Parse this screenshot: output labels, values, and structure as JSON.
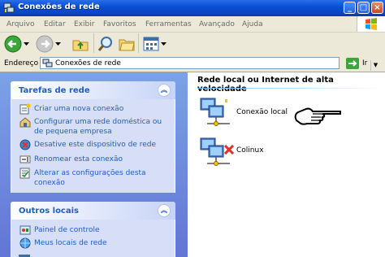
{
  "window": {
    "title": "Conexões de rede",
    "buttons": [
      "_",
      "□",
      "×"
    ]
  },
  "menu": [
    "Arquivo",
    "Editar",
    "Exibir",
    "Favoritos",
    "Ferramentas",
    "Avançado",
    "Ajuda"
  ],
  "toolbar": {
    "icons": [
      "back-arrow-icon",
      "dropdown-icon",
      "forward-arrow-icon",
      "dropdown-icon",
      "up-folder-icon",
      "search-icon",
      "folders-icon",
      "views-icon"
    ]
  },
  "address": {
    "label": "Endereço",
    "value": "Conexões de rede",
    "go_label": "Ir"
  },
  "left": {
    "tasks_title": "Tarefas de rede",
    "tasks": [
      {
        "label": "Criar uma nova conexão",
        "icon": "new-connection-icon"
      },
      {
        "label": "Configurar uma rede doméstica ou de pequena empresa",
        "icon": "home-network-icon"
      },
      {
        "label": "Desative este dispositivo de rede",
        "icon": "disable-device-icon"
      },
      {
        "label": "Renomear esta conexão",
        "icon": "rename-icon"
      },
      {
        "label": "Alterar as configurações desta conexão",
        "icon": "settings-icon"
      }
    ],
    "places_title": "Outros locais",
    "places": [
      {
        "label": "Painel de controle",
        "icon": "control-panel-icon"
      },
      {
        "label": "Meus locais de rede",
        "icon": "network-places-icon"
      }
    ]
  },
  "right": {
    "group_title": "Rede local ou Internet de alta velocidade",
    "connections": [
      {
        "label": "Conexão local",
        "status": "connected"
      },
      {
        "label": "Colinux",
        "status": "disconnected"
      }
    ]
  },
  "colors": {
    "title_blue": "#0a4fd6",
    "task_link": "#215dc6",
    "pane_blue": "#7ba2e7",
    "disconnected_x": "#e0302a"
  }
}
